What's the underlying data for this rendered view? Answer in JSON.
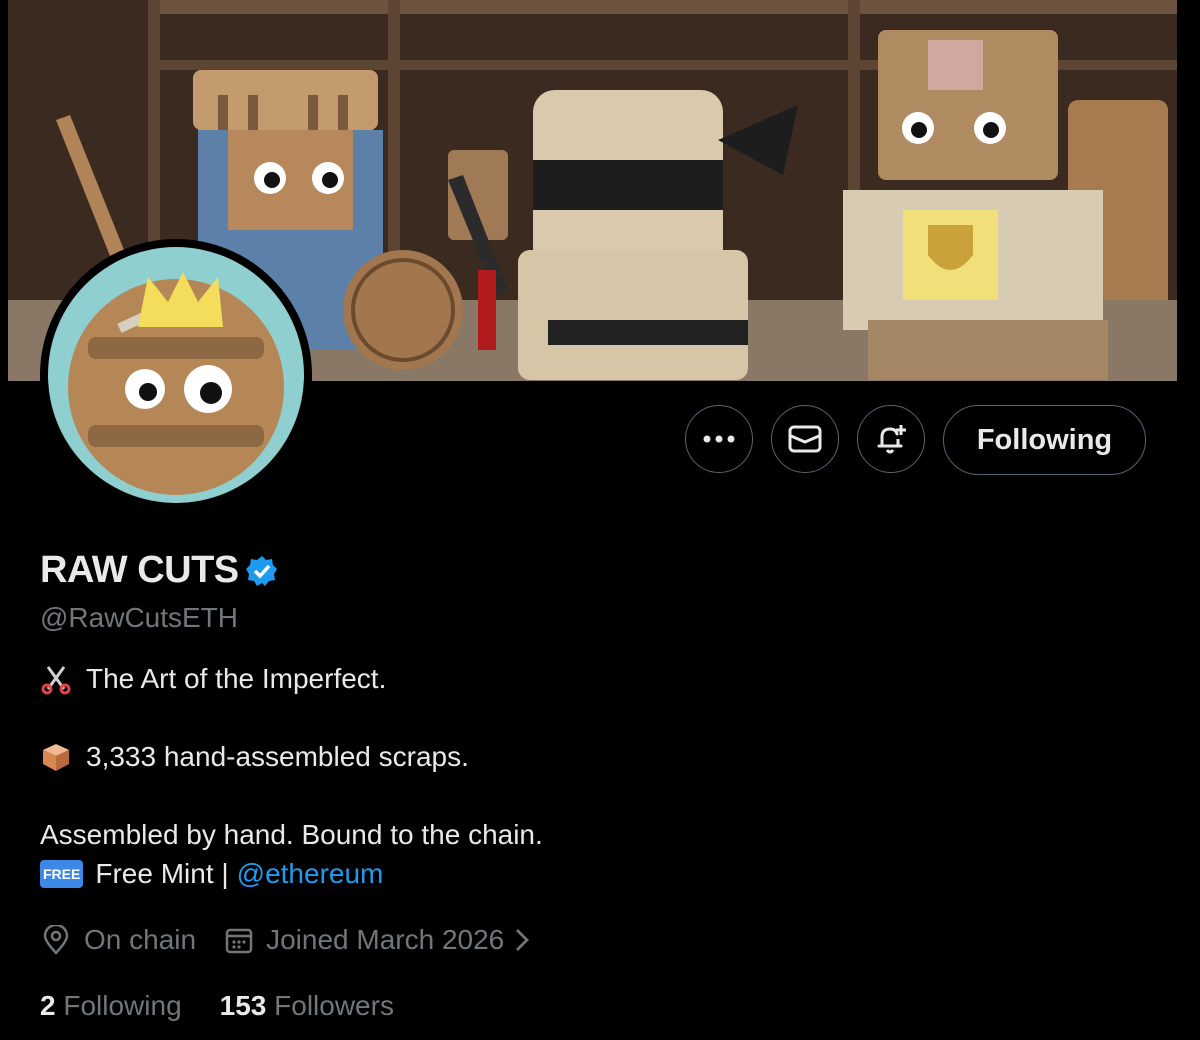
{
  "profile": {
    "name": "RAW CUTS",
    "handle": "@RawCutsETH",
    "verified": true,
    "bio": {
      "line1_icon": "scissors-emoji",
      "line1": "The Art of the Imperfect.",
      "line2_icon": "package-emoji",
      "line2": "3,333 hand-assembled scraps.",
      "line3": "Assembled by hand. Bound to the chain.",
      "line4_badge": "FREE",
      "line4_text": "Free Mint |",
      "line4_link": "@ethereum"
    },
    "location": "On chain",
    "joined": "Joined March 2026",
    "following_count": "2",
    "following_label": "Following",
    "followers_count": "153",
    "followers_label": "Followers"
  },
  "actions": {
    "more_icon": "more-icon",
    "message_icon": "mail-icon",
    "notify_icon": "bell-plus-icon",
    "follow_label": "Following"
  },
  "colors": {
    "background": "#000000",
    "text": "#e7e9ea",
    "muted": "#71767b",
    "accent": "#1d9bf0"
  }
}
